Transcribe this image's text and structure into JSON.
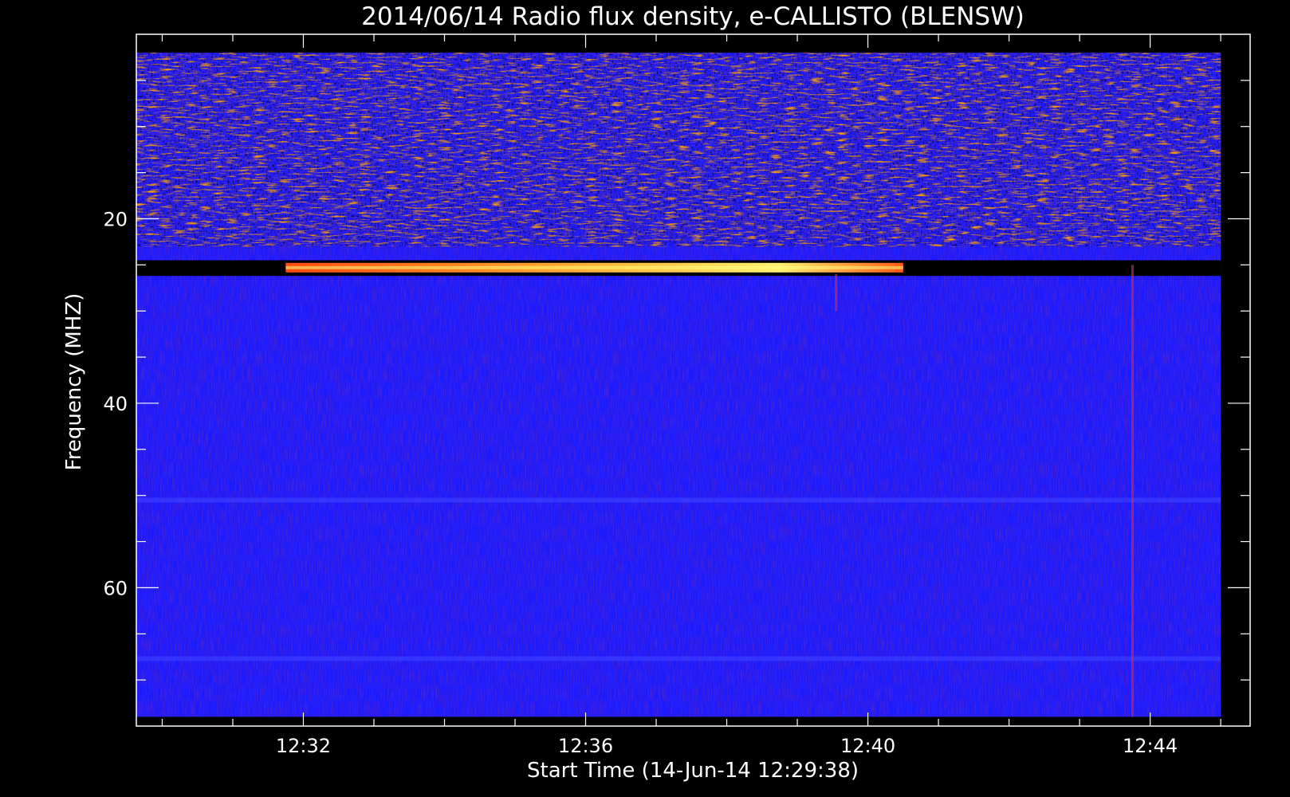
{
  "chart_data": {
    "type": "heatmap",
    "title": "2014/06/14  Radio flux density, e-CALLISTO (BLENSW)",
    "xlabel": "Start Time (14-Jun-14 12:29:38)",
    "ylabel": "Frequency (MHZ)",
    "x_axis": {
      "unit": "time of day",
      "range": [
        "12:29:38",
        "12:45:25"
      ],
      "data_extent": [
        "12:29:38",
        "12:45:00"
      ],
      "tick_labels": [
        "12:32",
        "12:36",
        "12:40",
        "12:44"
      ],
      "minor_tick_interval_min": 1
    },
    "y_axis": {
      "unit": "MHz",
      "range": [
        0,
        75
      ],
      "inverted": true,
      "data_extent": [
        2,
        74
      ],
      "tick_labels": [
        "20",
        "40",
        "60"
      ],
      "tick_values": [
        20,
        40,
        60
      ],
      "minor_tick_interval": 5
    },
    "colormap": [
      "#000000",
      "#1a1aff",
      "#ff2000",
      "#ffd000",
      "#ffff80"
    ],
    "features": [
      {
        "kind": "noisy-band",
        "freq_range": [
          2,
          23
        ],
        "intensity": "high"
      },
      {
        "kind": "gap",
        "freq_range": [
          24.5,
          26.2
        ],
        "intensity": "none"
      },
      {
        "kind": "bright-band",
        "freq": 25.3,
        "time_range": [
          "12:31:45",
          "12:40:30"
        ],
        "intensity": "very-high"
      },
      {
        "kind": "weak-line",
        "freq": 50.5,
        "intensity": "low"
      },
      {
        "kind": "weak-line",
        "freq": 67.7,
        "intensity": "low"
      },
      {
        "kind": "vertical-streak",
        "time": "12:43:45",
        "freq_range": [
          25,
          74
        ],
        "intensity": "medium"
      },
      {
        "kind": "vertical-streak",
        "time": "12:39:33",
        "freq_range": [
          26,
          30
        ],
        "intensity": "medium"
      }
    ]
  }
}
